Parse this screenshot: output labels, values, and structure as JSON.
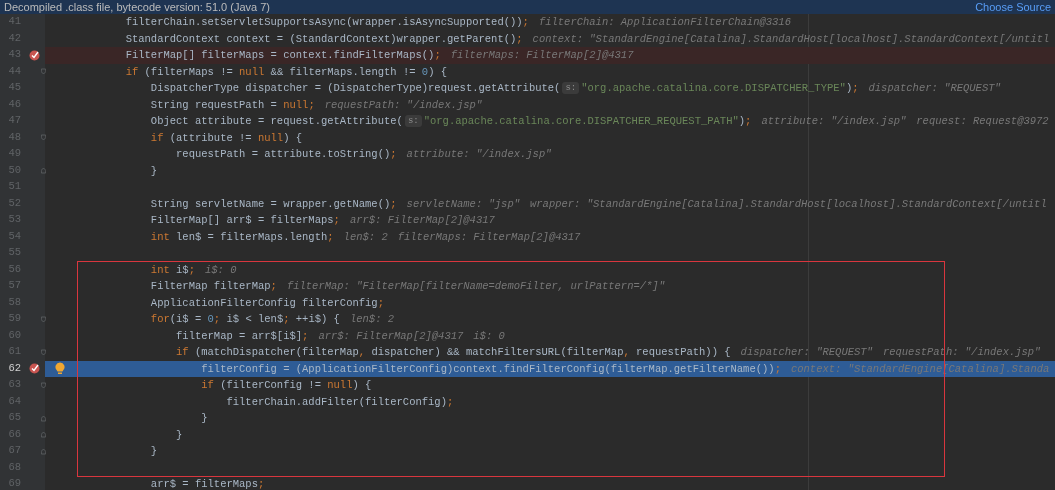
{
  "banner": {
    "message": "Decompiled .class file, bytecode version: 51.0 (Java 7)",
    "link": "Choose Source"
  },
  "lines": [
    {
      "number": "41",
      "breakpoint": false,
      "current": false,
      "bulb": false,
      "tokens": [
        {
          "kind": "plain",
          "text": "            filterChain.setServletSupportsAsync(wrapper.isAsyncSupported())"
        },
        {
          "kind": "punct",
          "text": ";"
        },
        {
          "kind": "hint",
          "text": "filterChain: ApplicationFilterChain@3316"
        }
      ]
    },
    {
      "number": "42",
      "breakpoint": false,
      "current": false,
      "bulb": false,
      "tokens": [
        {
          "kind": "plain",
          "text": "            StandardContext context = (StandardContext)wrapper.getParent()"
        },
        {
          "kind": "punct",
          "text": ";"
        },
        {
          "kind": "hint",
          "text": "context: \"StandardEngine[Catalina].StandardHost[localhost].StandardContext[/untitl"
        }
      ]
    },
    {
      "number": "43",
      "breakpoint": true,
      "current": false,
      "bulb": false,
      "tokens": [
        {
          "kind": "plain",
          "text": "            FilterMap[] filterMaps = context.findFilterMaps()"
        },
        {
          "kind": "punct",
          "text": ";"
        },
        {
          "kind": "hint",
          "text": "filterMaps: FilterMap[2]@4317"
        }
      ]
    },
    {
      "number": "44",
      "breakpoint": false,
      "current": false,
      "bulb": false,
      "kind": "block-start",
      "tokens": [
        {
          "kind": "keyword",
          "text": "            if"
        },
        {
          "kind": "plain",
          "text": " (filterMaps != "
        },
        {
          "kind": "keyword",
          "text": "null"
        },
        {
          "kind": "plain",
          "text": " && filterMaps.length != "
        },
        {
          "kind": "number",
          "text": "0"
        },
        {
          "kind": "plain",
          "text": ") {"
        }
      ]
    },
    {
      "number": "45",
      "breakpoint": false,
      "current": false,
      "bulb": false,
      "tokens": [
        {
          "kind": "plain",
          "text": "                DispatcherType dispatcher = (DispatcherType)request.getAttribute("
        },
        {
          "kind": "param",
          "text": "s:"
        },
        {
          "kind": "string",
          "text": "\"org.apache.catalina.core.DISPATCHER_TYPE\""
        },
        {
          "kind": "plain",
          "text": ")"
        },
        {
          "kind": "punct",
          "text": ";"
        },
        {
          "kind": "hint",
          "text": "dispatcher: \"REQUEST\""
        }
      ]
    },
    {
      "number": "46",
      "breakpoint": false,
      "current": false,
      "bulb": false,
      "tokens": [
        {
          "kind": "plain",
          "text": "                String requestPath = "
        },
        {
          "kind": "keyword",
          "text": "null"
        },
        {
          "kind": "punct",
          "text": ";"
        },
        {
          "kind": "hint",
          "text": "requestPath: \"/index.jsp\""
        }
      ]
    },
    {
      "number": "47",
      "breakpoint": false,
      "current": false,
      "bulb": false,
      "tokens": [
        {
          "kind": "plain",
          "text": "                Object attribute = request.getAttribute("
        },
        {
          "kind": "param",
          "text": "s:"
        },
        {
          "kind": "string",
          "text": "\"org.apache.catalina.core.DISPATCHER_REQUEST_PATH\""
        },
        {
          "kind": "plain",
          "text": ")"
        },
        {
          "kind": "punct",
          "text": ";"
        },
        {
          "kind": "hint",
          "text": "attribute: \"/index.jsp\""
        },
        {
          "kind": "hint",
          "text": "request: Request@3972"
        }
      ]
    },
    {
      "number": "48",
      "breakpoint": false,
      "current": false,
      "bulb": false,
      "kind": "block-start",
      "tokens": [
        {
          "kind": "keyword",
          "text": "                if"
        },
        {
          "kind": "plain",
          "text": " (attribute != "
        },
        {
          "kind": "keyword",
          "text": "null"
        },
        {
          "kind": "plain",
          "text": ") {"
        }
      ]
    },
    {
      "number": "49",
      "breakpoint": false,
      "current": false,
      "bulb": false,
      "tokens": [
        {
          "kind": "plain",
          "text": "                    requestPath = attribute.toString()"
        },
        {
          "kind": "punct",
          "text": ";"
        },
        {
          "kind": "hint",
          "text": "attribute: \"/index.jsp\""
        }
      ]
    },
    {
      "number": "50",
      "breakpoint": false,
      "current": false,
      "bulb": false,
      "kind": "block-end",
      "tokens": [
        {
          "kind": "plain",
          "text": "                }"
        }
      ]
    },
    {
      "number": "51",
      "breakpoint": false,
      "current": false,
      "bulb": false
    },
    {
      "number": "52",
      "breakpoint": false,
      "current": false,
      "bulb": false,
      "tokens": [
        {
          "kind": "plain",
          "text": "                String servletName = wrapper.getName()"
        },
        {
          "kind": "punct",
          "text": ";"
        },
        {
          "kind": "hint",
          "text": "servletName: \"jsp\""
        },
        {
          "kind": "hint",
          "text": "wrapper: \"StandardEngine[Catalina].StandardHost[localhost].StandardContext[/untitl"
        }
      ]
    },
    {
      "number": "53",
      "breakpoint": false,
      "current": false,
      "bulb": false,
      "tokens": [
        {
          "kind": "plain",
          "text": "                FilterMap[] arr$ = filterMaps"
        },
        {
          "kind": "punct",
          "text": ";"
        },
        {
          "kind": "hint",
          "text": "arr$: FilterMap[2]@4317"
        }
      ]
    },
    {
      "number": "54",
      "breakpoint": false,
      "current": false,
      "bulb": false,
      "tokens": [
        {
          "kind": "keyword",
          "text": "                int"
        },
        {
          "kind": "plain",
          "text": " len$ = filterMaps.length"
        },
        {
          "kind": "punct",
          "text": ";"
        },
        {
          "kind": "hint",
          "text": "len$: 2"
        },
        {
          "kind": "hint",
          "text": "filterMaps: FilterMap[2]@4317"
        }
      ]
    },
    {
      "number": "55",
      "breakpoint": false,
      "current": false,
      "bulb": false
    },
    {
      "number": "56",
      "breakpoint": false,
      "current": false,
      "bulb": false,
      "tokens": [
        {
          "kind": "keyword",
          "text": "                int"
        },
        {
          "kind": "plain",
          "text": " i$"
        },
        {
          "kind": "punct",
          "text": ";"
        },
        {
          "kind": "hint",
          "text": "i$: 0"
        }
      ]
    },
    {
      "number": "57",
      "breakpoint": false,
      "current": false,
      "bulb": false,
      "tokens": [
        {
          "kind": "plain",
          "text": "                FilterMap filterMap"
        },
        {
          "kind": "punct",
          "text": ";"
        },
        {
          "kind": "hint",
          "text": "filterMap: \"FilterMap[filterName=demoFilter, urlPattern=/*]\""
        }
      ]
    },
    {
      "number": "58",
      "breakpoint": false,
      "current": false,
      "bulb": false,
      "tokens": [
        {
          "kind": "plain",
          "text": "                ApplicationFilterConfig filterConfig"
        },
        {
          "kind": "punct",
          "text": ";"
        }
      ]
    },
    {
      "number": "59",
      "breakpoint": false,
      "current": false,
      "bulb": false,
      "kind": "block-start",
      "tokens": [
        {
          "kind": "keyword",
          "text": "                for"
        },
        {
          "kind": "plain",
          "text": "(i$ = "
        },
        {
          "kind": "number",
          "text": "0"
        },
        {
          "kind": "punct",
          "text": ";"
        },
        {
          "kind": "plain",
          "text": " i$ < len$"
        },
        {
          "kind": "punct",
          "text": ";"
        },
        {
          "kind": "plain",
          "text": " ++i$) {"
        },
        {
          "kind": "hint",
          "text": "len$: 2"
        }
      ]
    },
    {
      "number": "60",
      "breakpoint": false,
      "current": false,
      "bulb": false,
      "tokens": [
        {
          "kind": "plain",
          "text": "                    filterMap = arr$[i$]"
        },
        {
          "kind": "punct",
          "text": ";"
        },
        {
          "kind": "hint",
          "text": "arr$: FilterMap[2]@4317"
        },
        {
          "kind": "hint",
          "text": "i$: 0"
        }
      ]
    },
    {
      "number": "61",
      "breakpoint": false,
      "current": false,
      "bulb": false,
      "kind": "block-start",
      "tokens": [
        {
          "kind": "keyword",
          "text": "                    if"
        },
        {
          "kind": "plain",
          "text": " (matchDispatcher(filterMap"
        },
        {
          "kind": "punct",
          "text": ","
        },
        {
          "kind": "plain",
          "text": " dispatcher) && matchFiltersURL(filterMap"
        },
        {
          "kind": "punct",
          "text": ","
        },
        {
          "kind": "plain",
          "text": " requestPath)) {"
        },
        {
          "kind": "hint",
          "text": "dispatcher: \"REQUEST\""
        },
        {
          "kind": "hint",
          "text": "requestPath: \"/index.jsp\""
        }
      ]
    },
    {
      "number": "62",
      "breakpoint": true,
      "current": true,
      "bulb": true,
      "tokens": [
        {
          "kind": "plain",
          "text": "                        filterConfig = (ApplicationFilterConfig)context.findFilterConfig(filterMap.getFilterName())"
        },
        {
          "kind": "punct",
          "text": ";"
        },
        {
          "kind": "hint",
          "text": "context: \"StandardEngine[Catalina].Standa"
        }
      ]
    },
    {
      "number": "63",
      "breakpoint": false,
      "current": false,
      "bulb": false,
      "kind": "block-start",
      "tokens": [
        {
          "kind": "keyword",
          "text": "                        if"
        },
        {
          "kind": "plain",
          "text": " (filterConfig != "
        },
        {
          "kind": "keyword",
          "text": "null"
        },
        {
          "kind": "plain",
          "text": ") {"
        }
      ]
    },
    {
      "number": "64",
      "breakpoint": false,
      "current": false,
      "bulb": false,
      "tokens": [
        {
          "kind": "plain",
          "text": "                            filterChain.addFilter(filterConfig)"
        },
        {
          "kind": "punct",
          "text": ";"
        }
      ]
    },
    {
      "number": "65",
      "breakpoint": false,
      "current": false,
      "bulb": false,
      "kind": "block-end",
      "tokens": [
        {
          "kind": "plain",
          "text": "                        }"
        }
      ]
    },
    {
      "number": "66",
      "breakpoint": false,
      "current": false,
      "bulb": false,
      "kind": "block-end",
      "tokens": [
        {
          "kind": "plain",
          "text": "                    }"
        }
      ]
    },
    {
      "number": "67",
      "breakpoint": false,
      "current": false,
      "bulb": false,
      "kind": "block-end",
      "tokens": [
        {
          "kind": "plain",
          "text": "                }"
        }
      ]
    },
    {
      "number": "68",
      "breakpoint": false,
      "current": false,
      "bulb": false
    },
    {
      "number": "69",
      "breakpoint": false,
      "current": false,
      "bulb": false,
      "tokens": [
        {
          "kind": "plain",
          "text": "                arr$ = filterMaps"
        },
        {
          "kind": "punct",
          "text": ";"
        }
      ]
    }
  ]
}
